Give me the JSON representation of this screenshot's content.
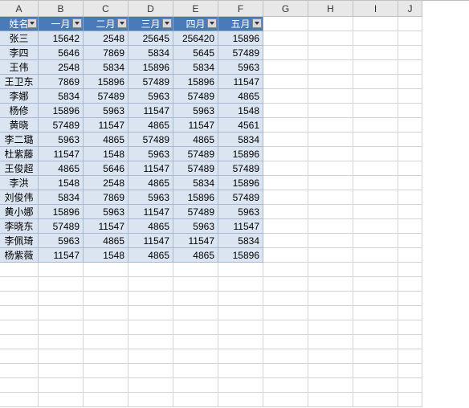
{
  "columns": [
    "A",
    "B",
    "C",
    "D",
    "E",
    "F",
    "G",
    "H",
    "I",
    "J"
  ],
  "headers": [
    "姓名",
    "一月",
    "二月",
    "三月",
    "四月",
    "五月"
  ],
  "rows": [
    {
      "name": "张三",
      "vals": [
        15642,
        2548,
        25645,
        256420,
        15896
      ]
    },
    {
      "name": "李四",
      "vals": [
        5646,
        7869,
        5834,
        5645,
        57489
      ]
    },
    {
      "name": "王伟",
      "vals": [
        2548,
        5834,
        15896,
        5834,
        5963
      ]
    },
    {
      "name": "王卫东",
      "vals": [
        7869,
        15896,
        57489,
        15896,
        11547
      ]
    },
    {
      "name": "李娜",
      "vals": [
        5834,
        57489,
        5963,
        57489,
        4865
      ]
    },
    {
      "name": "杨修",
      "vals": [
        15896,
        5963,
        11547,
        5963,
        1548
      ]
    },
    {
      "name": "黄晓",
      "vals": [
        57489,
        11547,
        4865,
        11547,
        4561
      ]
    },
    {
      "name": "李二璐",
      "vals": [
        5963,
        4865,
        57489,
        4865,
        5834
      ]
    },
    {
      "name": "杜紫藤",
      "vals": [
        11547,
        1548,
        5963,
        57489,
        15896
      ]
    },
    {
      "name": "王俊超",
      "vals": [
        4865,
        5646,
        11547,
        57489,
        57489
      ]
    },
    {
      "name": "李洪",
      "vals": [
        1548,
        2548,
        4865,
        5834,
        15896
      ]
    },
    {
      "name": "刘俊伟",
      "vals": [
        5834,
        7869,
        5963,
        15896,
        57489
      ]
    },
    {
      "name": "黄小娜",
      "vals": [
        15896,
        5963,
        11547,
        57489,
        5963
      ]
    },
    {
      "name": "李晓东",
      "vals": [
        57489,
        11547,
        4865,
        5963,
        11547
      ]
    },
    {
      "name": "李佩琦",
      "vals": [
        5963,
        4865,
        11547,
        11547,
        5834
      ]
    },
    {
      "name": "杨紫薇",
      "vals": [
        11547,
        1548,
        4865,
        4865,
        15896
      ]
    }
  ],
  "emptyRows": 10,
  "chart_data": {
    "type": "table",
    "title": "",
    "columns": [
      "姓名",
      "一月",
      "二月",
      "三月",
      "四月",
      "五月"
    ],
    "data": [
      [
        "张三",
        15642,
        2548,
        25645,
        256420,
        15896
      ],
      [
        "李四",
        5646,
        7869,
        5834,
        5645,
        57489
      ],
      [
        "王伟",
        2548,
        5834,
        15896,
        5834,
        5963
      ],
      [
        "王卫东",
        7869,
        15896,
        57489,
        15896,
        11547
      ],
      [
        "李娜",
        5834,
        57489,
        5963,
        57489,
        4865
      ],
      [
        "杨修",
        15896,
        5963,
        11547,
        5963,
        1548
      ],
      [
        "黄晓",
        57489,
        11547,
        4865,
        11547,
        4561
      ],
      [
        "李二璐",
        5963,
        4865,
        57489,
        4865,
        5834
      ],
      [
        "杜紫藤",
        11547,
        1548,
        5963,
        57489,
        15896
      ],
      [
        "王俊超",
        4865,
        5646,
        11547,
        57489,
        57489
      ],
      [
        "李洪",
        1548,
        2548,
        4865,
        5834,
        15896
      ],
      [
        "刘俊伟",
        5834,
        7869,
        5963,
        15896,
        57489
      ],
      [
        "黄小娜",
        15896,
        5963,
        11547,
        57489,
        5963
      ],
      [
        "李晓东",
        57489,
        11547,
        4865,
        5963,
        11547
      ],
      [
        "李佩琦",
        5963,
        4865,
        11547,
        11547,
        5834
      ],
      [
        "杨紫薇",
        11547,
        1548,
        4865,
        4865,
        15896
      ]
    ]
  }
}
